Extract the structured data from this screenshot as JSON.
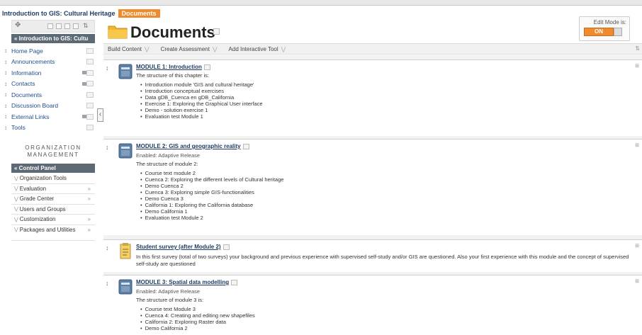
{
  "breadcrumb": {
    "course": "Introduction to GIS: Cultural Heritage",
    "current": "Documents"
  },
  "sidebar": {
    "course_title": "Introduction to GIS: Cultu",
    "menu": [
      {
        "label": "Home Page",
        "icon": false
      },
      {
        "label": "Announcements",
        "icon": false
      },
      {
        "label": "Information",
        "icon": true
      },
      {
        "label": "Contacts",
        "icon": true
      },
      {
        "label": "Documents",
        "icon": false
      },
      {
        "label": "Discussion Board",
        "icon": false
      },
      {
        "label": "External Links",
        "icon": true
      },
      {
        "label": "Tools",
        "icon": false
      }
    ],
    "org_title": "ORGANIZATION MANAGEMENT",
    "control_panel": "Control Panel",
    "cp_items": [
      {
        "label": "Organization Tools",
        "arrow": false
      },
      {
        "label": "Evaluation",
        "arrow": true
      },
      {
        "label": "Grade Center",
        "arrow": true
      },
      {
        "label": "Users and Groups",
        "arrow": false
      },
      {
        "label": "Customization",
        "arrow": true
      },
      {
        "label": "Packages and Utilities",
        "arrow": true
      }
    ]
  },
  "page": {
    "title": "Documents",
    "edit_mode_label": "Edit Mode is:",
    "edit_mode_value": "ON"
  },
  "actions": [
    "Build Content",
    "Create Assessment",
    "Add Interactive Tool"
  ],
  "items": [
    {
      "title": "MODULE 1: Introduction",
      "enabled": "",
      "intro": "The structure of this chapter is:",
      "bullets": [
        "Introduction module 'GIS and cultural heritage'",
        "Introduction conceptual exercises",
        "Data gDB_Cuenca en gDB_California",
        "Exercise 1: Exploring the Graphical User interface",
        "Demo - solution exercise 1",
        "Evaluation test Module 1"
      ]
    },
    {
      "title": "MODULE 2: GIS and geographic reality",
      "enabled": "Enabled:  Adaptive Release",
      "intro": "The structure of module 2:",
      "bullets": [
        "Course text module 2",
        "Cuenca 2: Exploring the different levels of Cultural heritage",
        "Demo Cuenca 2",
        "Cuenca 3: Exploring simple GIS-functionalities",
        "Demo Cuenca 3",
        "California 1: Exploring the California database",
        "Demo California 1",
        "Evaluation test Module 2"
      ]
    },
    {
      "title": "Student survey (after Module 2)",
      "enabled": "",
      "intro": "In this first survey (total of two surveys) your background and previous experience with supervised self-study and/or GIS are questioned. Also your first experience with this module and the concept of supervised self-study are questioned",
      "bullets": []
    },
    {
      "title": "MODULE 3: Spatial data modelling",
      "enabled": "Enabled:  Adaptive Release",
      "intro": "The structure of module 3 is:",
      "bullets": [
        "Course text Module 3",
        "Cuenca 4: Creating and editing new shapefiles",
        "California 2: Exploring Raster data",
        "Demo California 2"
      ]
    }
  ]
}
